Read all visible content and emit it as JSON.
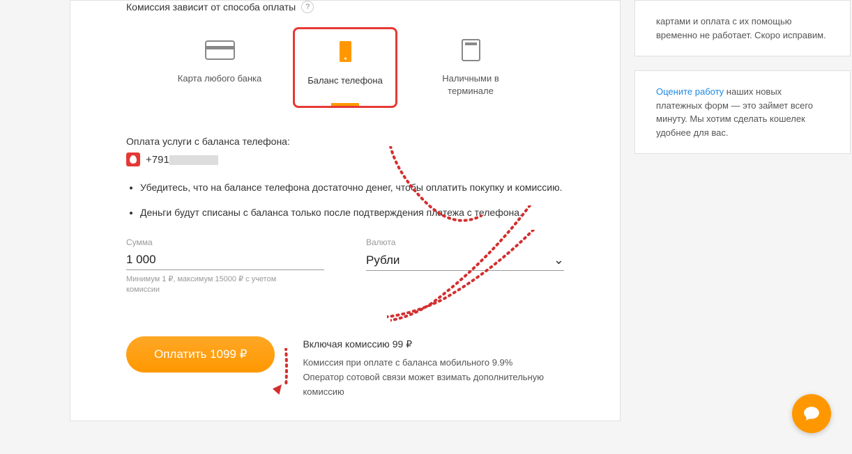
{
  "commission_label": "Комиссия зависит от способа оплаты",
  "help_symbol": "?",
  "payment_methods": [
    {
      "id": "card",
      "label": "Карта любого банка"
    },
    {
      "id": "phone",
      "label": "Баланс телефона"
    },
    {
      "id": "terminal",
      "label": "Наличными в терминале"
    }
  ],
  "phone_section": {
    "title": "Оплата услуги с баланса телефона:",
    "number_prefix": "+791"
  },
  "bullets": [
    "Убедитесь, что на балансе телефона достаточно денег, чтобы оплатить покупку и комиссию.",
    "Деньги будут списаны с баланса только после подтверждения платежа с телефона."
  ],
  "form": {
    "amount_label": "Сумма",
    "amount_value": "1 000",
    "amount_helper": "Минимум 1 ₽, максимум 15000 ₽ с учетом комиссии",
    "currency_label": "Валюта",
    "currency_value": "Рубли"
  },
  "pay_button": "Оплатить 1099 ₽",
  "fee_info": {
    "title": "Включая комиссию 99 ₽",
    "line1": "Комиссия при оплате с баланса мобильного 9.9%",
    "line2": "Оператор сотовой связи может взимать дополнительную комиссию"
  },
  "right_panels": {
    "panel1": "картами и оплата с их помощью временно не работает. Скоро исправим.",
    "panel2_link": "Оцените работу",
    "panel2_text": " наших новых платежных форм — это займет всего минуту. Мы хотим сделать кошелек удобнее для вас."
  }
}
